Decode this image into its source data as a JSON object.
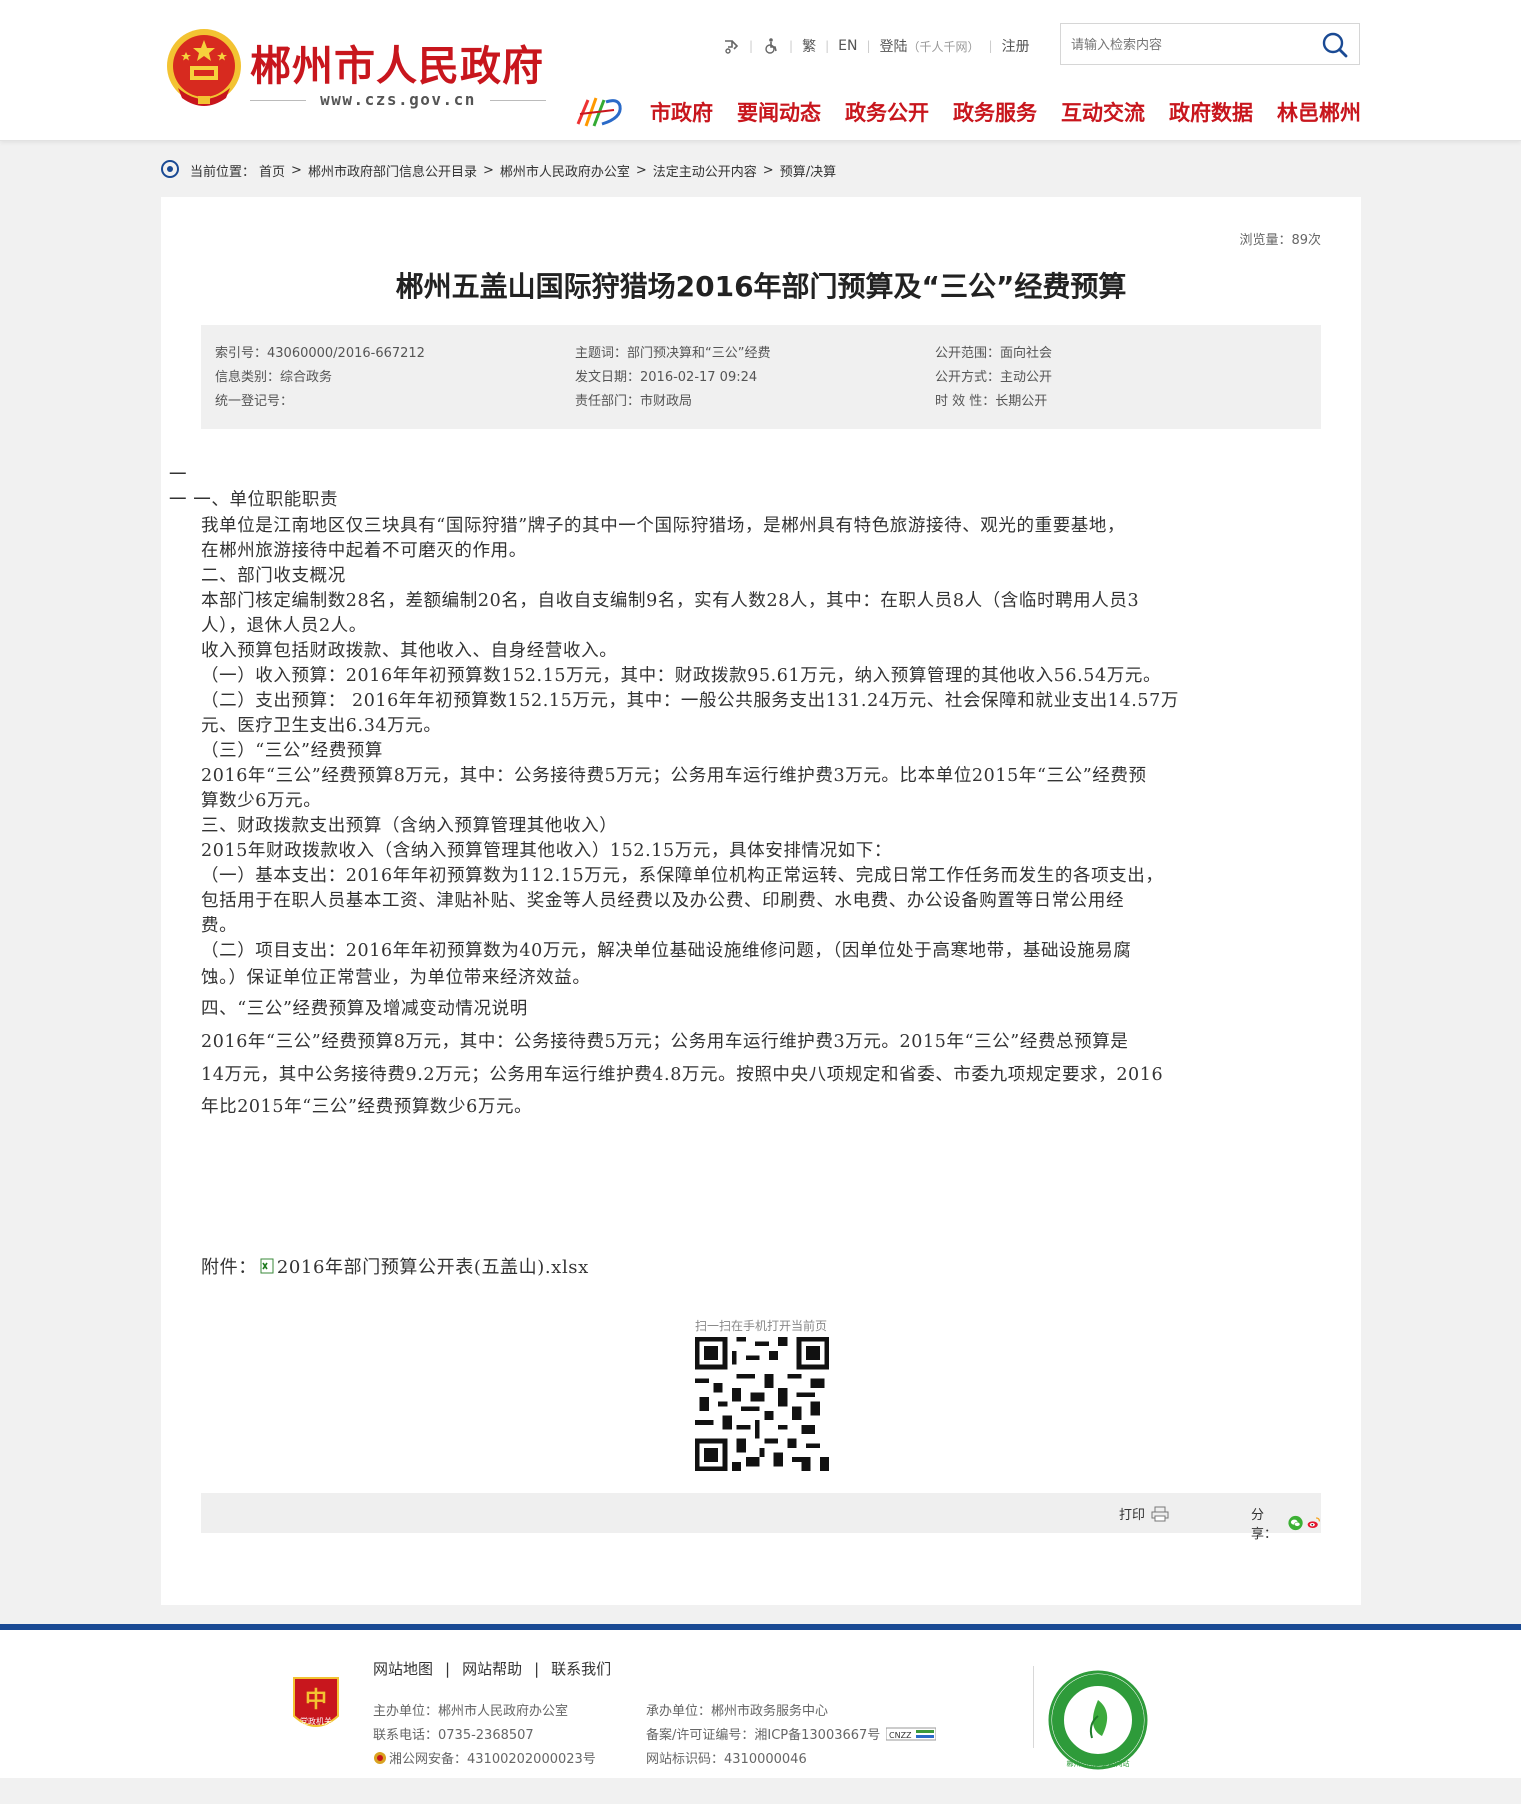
{
  "header": {
    "site_name": "郴州市人民政府",
    "site_domain": "www.czs.gov.cn",
    "emblem_icon": "national-emblem-icon",
    "toplinks": {
      "accessibility_icon": "accessibility-icon",
      "traditional": "繁",
      "english": "EN",
      "login": "登陆",
      "login_note": "（千人千网）",
      "register": "注册"
    },
    "search": {
      "placeholder": "请输入检索内容",
      "icon": "search-icon"
    },
    "nav": [
      "市政府",
      "要闻动态",
      "政务公开",
      "政务服务",
      "互动交流",
      "政府数据",
      "林邑郴州"
    ]
  },
  "breadcrumb": {
    "label": "当前位置：",
    "items": [
      "首页",
      "郴州市政府部门信息公开目录",
      "郴州市人民政府办公室",
      "法定主动公开内容",
      "预算/决算"
    ],
    "separator": ">"
  },
  "article": {
    "views": "浏览量：89次",
    "title": "郴州五盖山国际狩猎场2016年部门预算及“三公”经费预算",
    "meta": {
      "index_no": "索引号：43060000/2016-667212",
      "info_category": "信息类别：综合政务",
      "unified_reg": "统一登记号：",
      "subject": "主题词：部门预决算和“三公”经费",
      "issue_date": "发文日期：2016-02-17 09:24",
      "department": "责任部门：市财政局",
      "scope": "公开范围：面向社会",
      "method": "公开方式：主动公开",
      "validity": "时 效 性：长期公开"
    },
    "body": [
      "一",
      "一  一、单位职能职责",
      "我单位是江南地区仅三块具有“国际狩猎”牌子的其中一个国际狩猎场，是郴州具有特色旅游接待、观光的重要基地，",
      "在郴州旅游接待中起着不可磨灭的作用。",
      "二、部门收支概况",
      "本部门核定编制数28名，差额编制20名，自收自支编制9名，实有人数28人，其中：在职人员8人（含临时聘用人员3",
      "人），退休人员2人。",
      "收入预算包括财政拨款、其他收入、自身经营收入。",
      "（一）收入预算：2016年年初预算数152.15万元，其中：财政拨款95.61万元，纳入预算管理的其他收入56.54万元。",
      "（二）支出预算： 2016年年初预算数152.15万元，其中：一般公共服务支出131.24万元、社会保障和就业支出14.57万",
      "元、医疗卫生支出6.34万元。",
      "（三）“三公”经费预算",
      "2016年“三公”经费预算8万元，其中：公务接待费5万元；公务用车运行维护费3万元。比本单位2015年“三公”经费预",
      "算数少6万元。",
      "三、财政拨款支出预算（含纳入预算管理其他收入）",
      "2015年财政拨款收入（含纳入预算管理其他收入）152.15万元，具体安排情况如下：",
      "（一）基本支出：2016年年初预算数为112.15万元，系保障单位机构正常运转、完成日常工作任务而发生的各项支出，",
      "包括用于在职人员基本工资、津贴补贴、奖金等人员经费以及办公费、印刷费、水电费、办公设备购置等日常公用经",
      "费。",
      "（二）项目支出：2016年年初预算数为40万元，解决单位基础设施维修问题，（因单位处于高寒地带，基础设施易腐",
      "蚀。）保证单位正常营业，为单位带来经济效益。",
      "四、“三公”经费预算及增减变动情况说明",
      " 2016年“三公”经费预算8万元，其中：公务接待费5万元；公务用车运行维护费3万元。2015年“三公”经费总预算是",
      "14万元，其中公务接待费9.2万元；公务用车运行维护费4.8万元。按照中央八项规定和省委、市委九项规定要求，2016",
      "年比2015年“三公”经费预算数少6万元。"
    ],
    "attachment_label": "附件：",
    "attachment_name": "2016年部门预算公开表(五盖山).xlsx",
    "qr_caption": "扫一扫在手机打开当前页",
    "print_label": "打印",
    "share_label": "分享："
  },
  "footer": {
    "links": [
      "网站地图",
      "网站帮助",
      "联系我们"
    ],
    "host": "主办单位：郴州市人民政府办公室",
    "phone": "联系电话：0735-2368507",
    "police": "湘公网安备：43100202000023号",
    "operator": "承办单位：郴州市政务服务中心",
    "icp": "备案/许可证编号：湘ICP备13003667号",
    "site_id": "网站标识码：4310000046",
    "badge_text": "党政机关",
    "seal_text": "郴州市创建文明网站"
  },
  "colors": {
    "brand_red": "#c8161d",
    "footer_blue": "#1a4a94"
  }
}
